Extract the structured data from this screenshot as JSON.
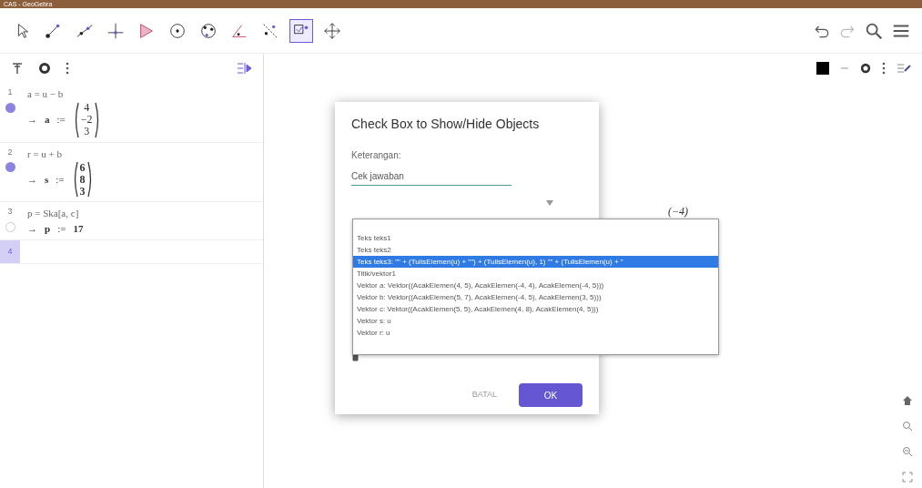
{
  "window": {
    "title": "CAS - GeoGebra"
  },
  "toolbar": {
    "tools": [
      {
        "kind": "pointer",
        "selected": false
      },
      {
        "kind": "point",
        "selected": false
      },
      {
        "kind": "line",
        "selected": false
      },
      {
        "kind": "perpendicular",
        "selected": false
      },
      {
        "kind": "polygon",
        "selected": false
      },
      {
        "kind": "circle",
        "selected": false
      },
      {
        "kind": "circle3",
        "selected": false
      },
      {
        "kind": "angle",
        "selected": false
      },
      {
        "kind": "reflect",
        "selected": false
      },
      {
        "kind": "checkbox",
        "selected": true
      },
      {
        "kind": "move",
        "selected": false
      }
    ]
  },
  "algebra": {
    "rows": [
      {
        "number": "1",
        "definition": "a = u − b",
        "arrow": "→",
        "name": "a",
        "assign": ":=",
        "kind": "vector",
        "values": [
          "4",
          "−2",
          "3"
        ],
        "visible": true
      },
      {
        "number": "2",
        "definition": "r = u + b",
        "arrow": "→",
        "name": "s",
        "assign": ":=",
        "kind": "vector",
        "values": [
          "6",
          "8",
          "3"
        ],
        "visible": true
      },
      {
        "number": "3",
        "definition": "p = Ska[a, c]",
        "arrow": "→",
        "name": "p",
        "assign": ":=",
        "kind": "number",
        "values": [
          "17"
        ],
        "visible": false
      }
    ],
    "input_number": "4"
  },
  "graphics": {
    "fragment": "(−4)"
  },
  "dialog": {
    "title": "Check Box to Show/Hide Objects",
    "caption_label": "Keterangan:",
    "caption_value": "Cek jawaban",
    "options": [
      {
        "label": "Teks teks1",
        "selected": false
      },
      {
        "label": "Teks teks2",
        "selected": false
      },
      {
        "label": "Teks teks3: \"\" + (TulisElemen(u) + \"\") + (TulisElemen(u), 1) \"\" + (TulisElemen(u) + \"",
        "selected": true
      },
      {
        "label": "Titik/vektor1",
        "selected": false
      },
      {
        "label": "Vektor a: Vektor((AcakElemen(4, 5), AcakElemen(-4, 4), AcakElemen(-4, 5)))",
        "selected": false
      },
      {
        "label": "Vektor b: Vektor((AcakElemen(5, 7), AcakElemen(-4, 5), AcakElemen(3, 5)))",
        "selected": false
      },
      {
        "label": "Vektor c: Vektor((AcakElemen(5, 5), AcakElemen(4, 8), AcakElemen(4, 5)))",
        "selected": false
      },
      {
        "label": "Vektor s: u",
        "selected": false
      },
      {
        "label": "Vektor r: u",
        "selected": false
      }
    ],
    "buttons": [
      {
        "label": "BATAL",
        "kind": "text"
      },
      {
        "label": "OK",
        "kind": "primary"
      }
    ]
  }
}
